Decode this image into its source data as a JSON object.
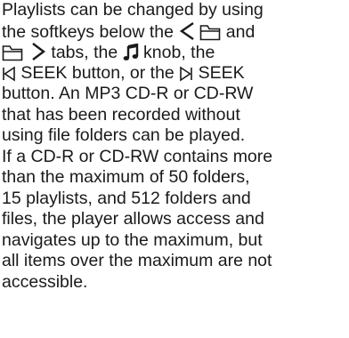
{
  "paragraph": {
    "l1": "Playlists can be changed by using",
    "l2a": "the softkeys below the ",
    "l2b": " and",
    "l3a": " tabs, the ",
    "l3b": " knob, the",
    "l4a": " SEEK button, or the ",
    "l4b": " SEEK",
    "l5": "button. An MP3 CD-R or CD-RW",
    "l6": "that has been recorded without",
    "l7": "using file folders can be played.",
    "l8": "If a CD-R or CD-RW contains more",
    "l9": "than the maximum of 50 folders,",
    "l10": "15 playlists, and 512 folders and",
    "l11": "files, the player allows access and",
    "l12": "navigates up to the maximum, but",
    "l13": "all items over the maximum are not",
    "l14": "accessible."
  },
  "icons": {
    "left_arrow": "chevron-left-icon",
    "folder": "folder-icon",
    "right_arrow": "chevron-right-icon",
    "music_note": "music-note-icon",
    "seek_back": "seek-back-icon",
    "seek_forward": "seek-forward-icon"
  }
}
